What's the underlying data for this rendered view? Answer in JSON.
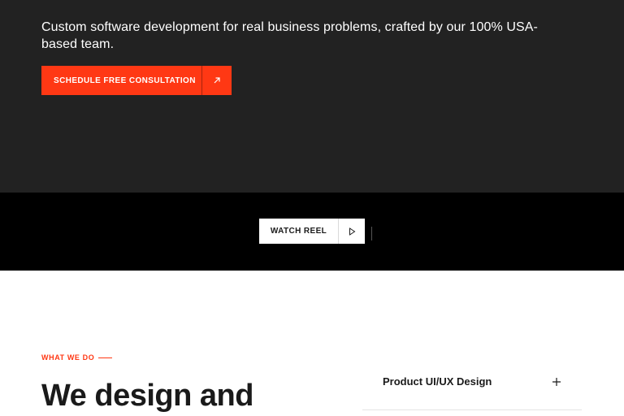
{
  "hero": {
    "subtitle": "Custom software development for real business problems, crafted by our 100% USA-based team.",
    "cta_label": "SCHEDULE FREE CONSULTATION",
    "cta_icon": "arrow-up-right-icon",
    "accent_color": "#ff3814",
    "background_color": "#222222"
  },
  "reel": {
    "button_label": "WATCH REEL",
    "button_icon": "play-icon",
    "background_color": "#000000"
  },
  "services": {
    "eyebrow": "WHAT WE DO",
    "headline": "We design and",
    "accordion": [
      {
        "label": "Product UI/UX Design",
        "icon": "plus-icon"
      }
    ]
  }
}
